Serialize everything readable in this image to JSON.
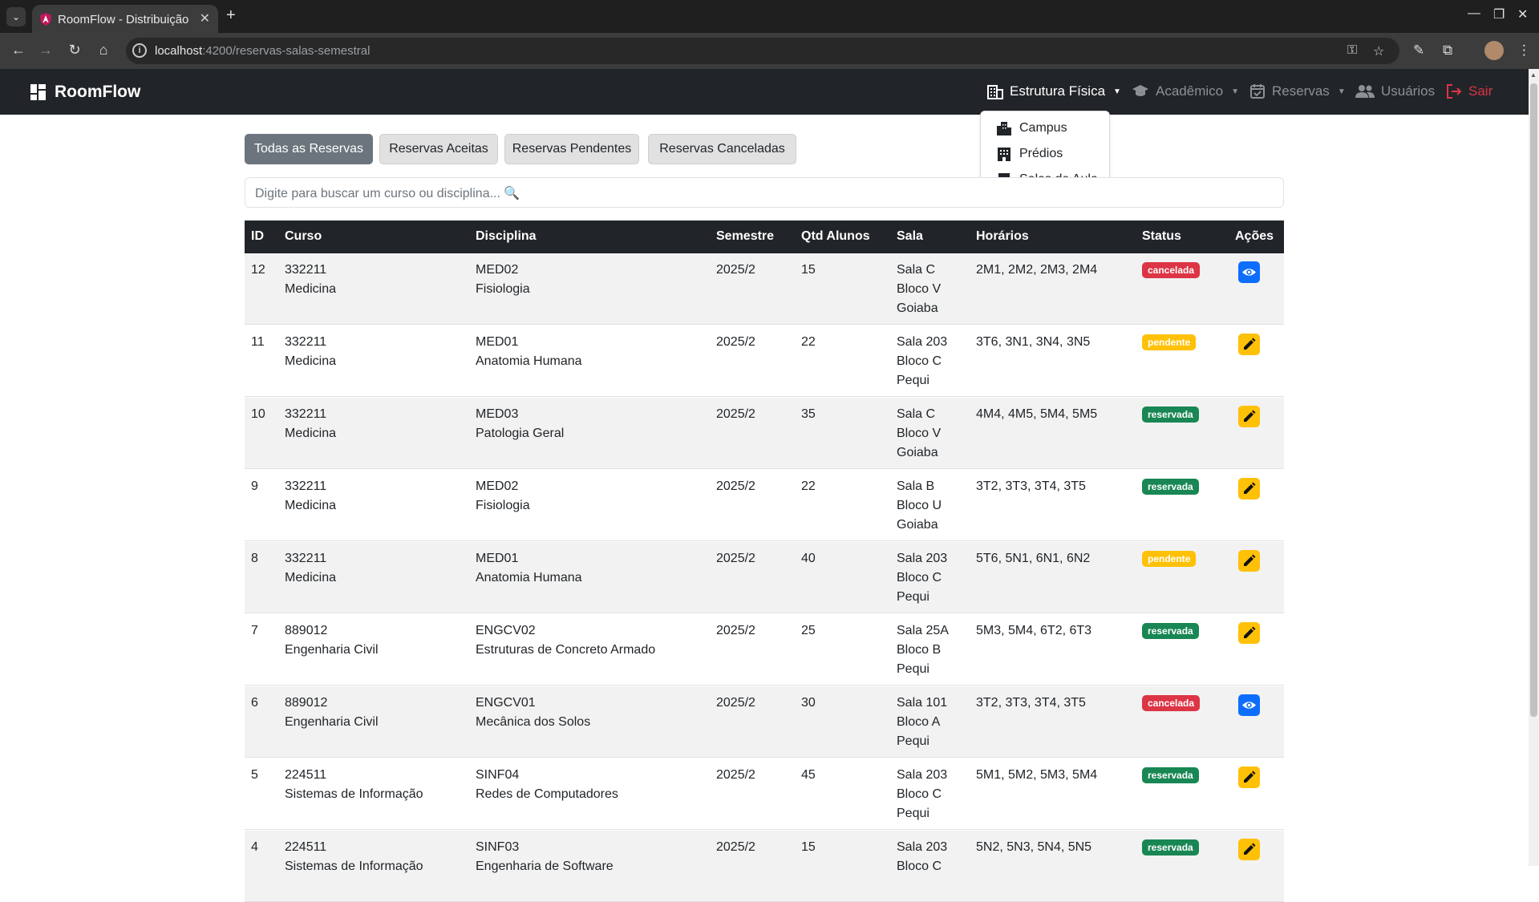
{
  "browser": {
    "tab_title": "RoomFlow - Distribuição",
    "url_host": "localhost",
    "url_path": ":4200/reservas-salas-semestral"
  },
  "navbar": {
    "brand": "RoomFlow",
    "items": [
      {
        "label": "Estrutura Física",
        "icon": "building-icon"
      },
      {
        "label": "Acadêmico",
        "icon": "graduation-cap-icon"
      },
      {
        "label": "Reservas",
        "icon": "calendar-check-icon"
      },
      {
        "label": "Usuários",
        "icon": "users-icon"
      },
      {
        "label": "Sair",
        "icon": "logout-icon"
      }
    ],
    "dropdown": [
      {
        "label": "Campus",
        "icon": "city-icon"
      },
      {
        "label": "Prédios",
        "icon": "building-icon"
      },
      {
        "label": "Salas de Aula",
        "icon": "door-icon"
      }
    ]
  },
  "filters": [
    "Todas as Reservas",
    "Reservas Aceitas",
    "Reservas Pendentes",
    "Reservas Canceladas"
  ],
  "search": {
    "placeholder": "Digite para buscar um curso ou disciplina... 🔍"
  },
  "table": {
    "headers": [
      "ID",
      "Curso",
      "Disciplina",
      "Semestre",
      "Qtd Alunos",
      "Sala",
      "Horários",
      "Status",
      "Ações"
    ],
    "rows": [
      {
        "id": "12",
        "curso_code": "332211",
        "curso_name": "Medicina",
        "disc_code": "MED02",
        "disc_name": "Fisiologia",
        "semestre": "2025/2",
        "qtd": "15",
        "sala": "Sala C",
        "bloco": "Bloco V",
        "campus": "Goiaba",
        "horarios": "2M1, 2M2, 2M3, 2M4",
        "status": "cancelada",
        "action": "view"
      },
      {
        "id": "11",
        "curso_code": "332211",
        "curso_name": "Medicina",
        "disc_code": "MED01",
        "disc_name": "Anatomia Humana",
        "semestre": "2025/2",
        "qtd": "22",
        "sala": "Sala 203",
        "bloco": "Bloco C",
        "campus": "Pequi",
        "horarios": "3T6, 3N1, 3N4, 3N5",
        "status": "pendente",
        "action": "edit"
      },
      {
        "id": "10",
        "curso_code": "332211",
        "curso_name": "Medicina",
        "disc_code": "MED03",
        "disc_name": "Patologia Geral",
        "semestre": "2025/2",
        "qtd": "35",
        "sala": "Sala C",
        "bloco": "Bloco V",
        "campus": "Goiaba",
        "horarios": "4M4, 4M5, 5M4, 5M5",
        "status": "reservada",
        "action": "edit"
      },
      {
        "id": "9",
        "curso_code": "332211",
        "curso_name": "Medicina",
        "disc_code": "MED02",
        "disc_name": "Fisiologia",
        "semestre": "2025/2",
        "qtd": "22",
        "sala": "Sala B",
        "bloco": "Bloco U",
        "campus": "Goiaba",
        "horarios": "3T2, 3T3, 3T4, 3T5",
        "status": "reservada",
        "action": "edit"
      },
      {
        "id": "8",
        "curso_code": "332211",
        "curso_name": "Medicina",
        "disc_code": "MED01",
        "disc_name": "Anatomia Humana",
        "semestre": "2025/2",
        "qtd": "40",
        "sala": "Sala 203",
        "bloco": "Bloco C",
        "campus": "Pequi",
        "horarios": "5T6, 5N1, 6N1, 6N2",
        "status": "pendente",
        "action": "edit"
      },
      {
        "id": "7",
        "curso_code": "889012",
        "curso_name": "Engenharia Civil",
        "disc_code": "ENGCV02",
        "disc_name": "Estruturas de Concreto Armado",
        "semestre": "2025/2",
        "qtd": "25",
        "sala": "Sala 25A",
        "bloco": "Bloco B",
        "campus": "Pequi",
        "horarios": "5M3, 5M4, 6T2, 6T3",
        "status": "reservada",
        "action": "edit"
      },
      {
        "id": "6",
        "curso_code": "889012",
        "curso_name": "Engenharia Civil",
        "disc_code": "ENGCV01",
        "disc_name": "Mecânica dos Solos",
        "semestre": "2025/2",
        "qtd": "30",
        "sala": "Sala 101",
        "bloco": "Bloco A",
        "campus": "Pequi",
        "horarios": "3T2, 3T3, 3T4, 3T5",
        "status": "cancelada",
        "action": "view"
      },
      {
        "id": "5",
        "curso_code": "224511",
        "curso_name": "Sistemas de Informação",
        "disc_code": "SINF04",
        "disc_name": "Redes de Computadores",
        "semestre": "2025/2",
        "qtd": "45",
        "sala": "Sala 203",
        "bloco": "Bloco C",
        "campus": "Pequi",
        "horarios": "5M1, 5M2, 5M3, 5M4",
        "status": "reservada",
        "action": "edit"
      },
      {
        "id": "4",
        "curso_code": "224511",
        "curso_name": "Sistemas de Informação",
        "disc_code": "SINF03",
        "disc_name": "Engenharia de Software",
        "semestre": "2025/2",
        "qtd": "15",
        "sala": "Sala 203",
        "bloco": "Bloco C",
        "campus": "",
        "horarios": "5N2, 5N3, 5N4, 5N5",
        "status": "reservada",
        "action": "edit"
      }
    ]
  },
  "colors": {
    "navbar_bg": "#212529",
    "cancelada": "#dc3545",
    "pendente": "#ffc107",
    "reservada": "#198754",
    "view_button": "#0d6efd",
    "edit_button": "#ffc107"
  }
}
